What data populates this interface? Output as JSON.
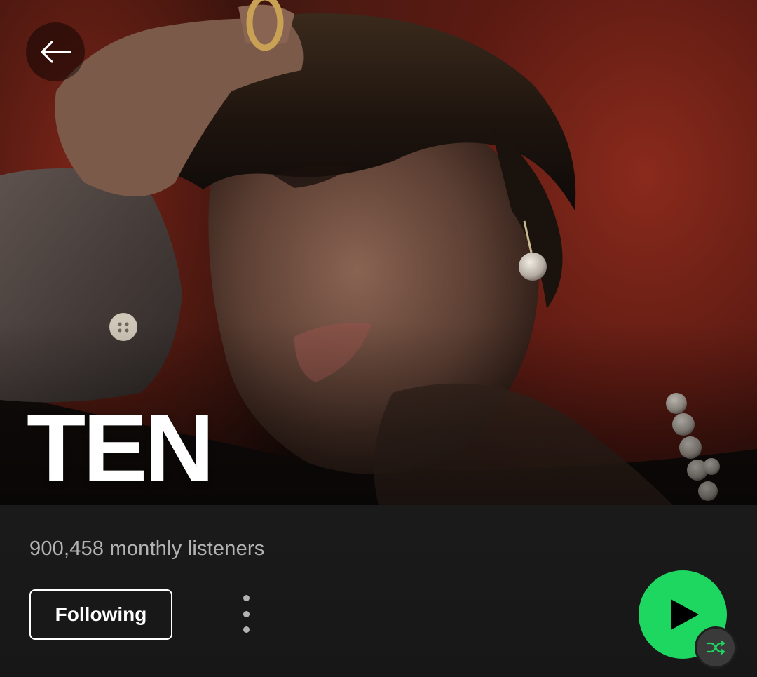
{
  "artist": {
    "name": "TEN",
    "monthly_listeners": "900,458 monthly listeners"
  },
  "actions": {
    "follow_label": "Following"
  },
  "icons": {
    "back": "arrow-left-icon",
    "more": "more-vertical-icon",
    "play": "play-icon",
    "shuffle": "shuffle-icon"
  },
  "colors": {
    "accent": "#1ed760",
    "background": "#1c1c1c",
    "text_primary": "#ffffff",
    "text_secondary": "#b3b3b3"
  }
}
